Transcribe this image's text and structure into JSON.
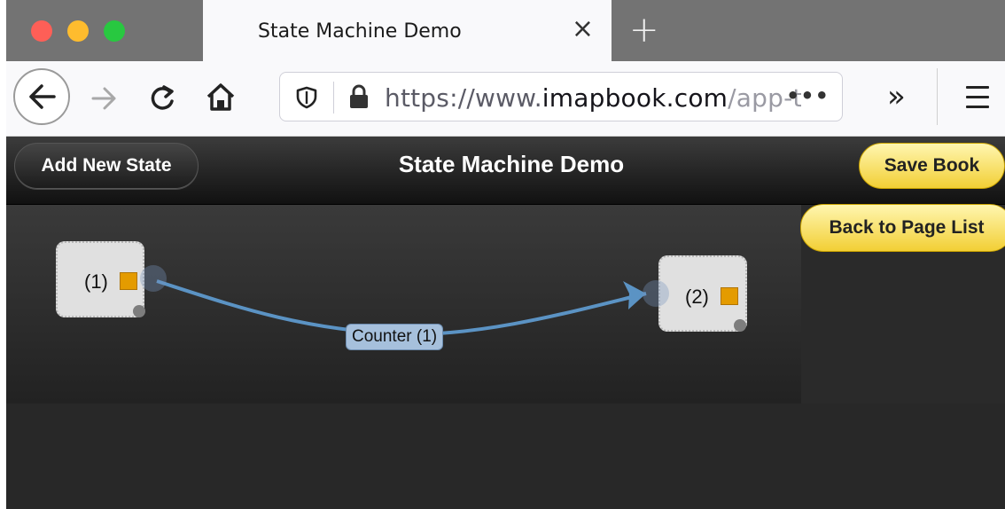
{
  "browser": {
    "tab": {
      "title": "State Machine Demo",
      "close_icon": "×"
    },
    "new_tab_icon": "+",
    "url": {
      "prefix": "https://www.",
      "domain": "imapbook.com",
      "suffix": "/app-te",
      "more": "•••"
    },
    "overflow_icon": "»"
  },
  "app": {
    "title": "State Machine Demo",
    "add_state_label": "Add New State",
    "save_label": "Save Book",
    "back_label": "Back to Page List",
    "colors": {
      "accent_yellow": "#f2cf35",
      "edge": "#5b93c4",
      "handle": "#e49b00"
    }
  },
  "diagram": {
    "nodes": [
      {
        "label": "(1)"
      },
      {
        "label": "(2)"
      }
    ],
    "edges": [
      {
        "from": "(1)",
        "to": "(2)",
        "label": "Counter (1)"
      }
    ]
  }
}
